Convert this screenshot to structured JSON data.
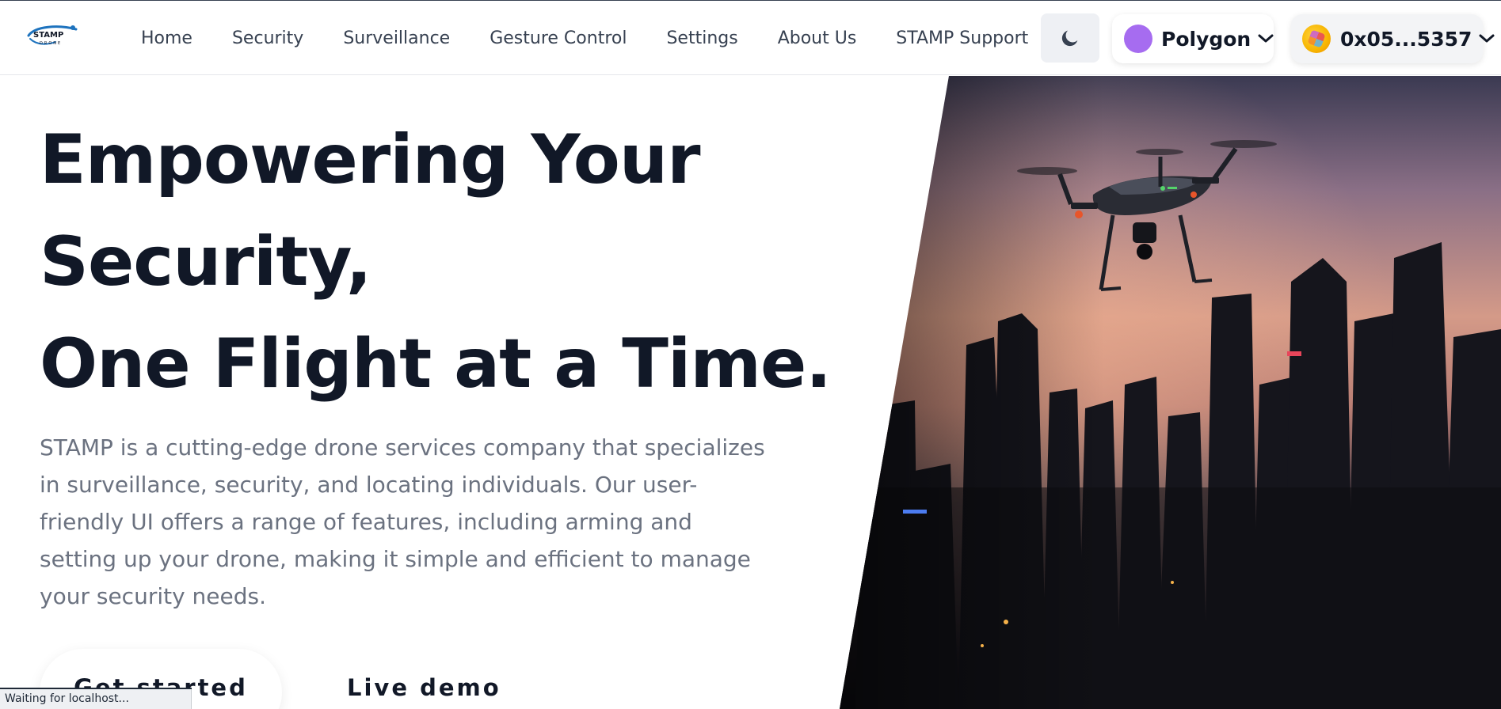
{
  "header": {
    "logo": {
      "text": "STAMP",
      "subtext": "DRONE",
      "icon": "drone-logo-icon"
    },
    "nav": [
      "Home",
      "Security",
      "Surveillance",
      "Gesture Control",
      "Settings",
      "About Us",
      "STAMP Support"
    ],
    "theme_toggle_icon": "moon-icon",
    "network": {
      "label": "Polygon",
      "color": "#a66cf0",
      "icon": "chevron-down-icon"
    },
    "wallet": {
      "address": "0x05...5357",
      "icon": "chevron-down-icon"
    }
  },
  "hero": {
    "title_lines": [
      "Empowering Your",
      "Security,",
      "One Flight at a Time."
    ],
    "description": "STAMP is a cutting-edge drone services company that specializes in surveillance, security, and locating individuals. Our user-friendly UI offers a range of features, including arming and setting up your drone, making it simple and efficient to manage your security needs.",
    "primary_cta": "Get started",
    "secondary_cta": "Live demo",
    "image": "drone-over-city-skyline-image"
  },
  "status_bar": {
    "text": "Waiting for localhost..."
  },
  "colors": {
    "title": "#111827",
    "body": "#6b7280",
    "nav": "#374151",
    "accent": "#a66cf0"
  }
}
